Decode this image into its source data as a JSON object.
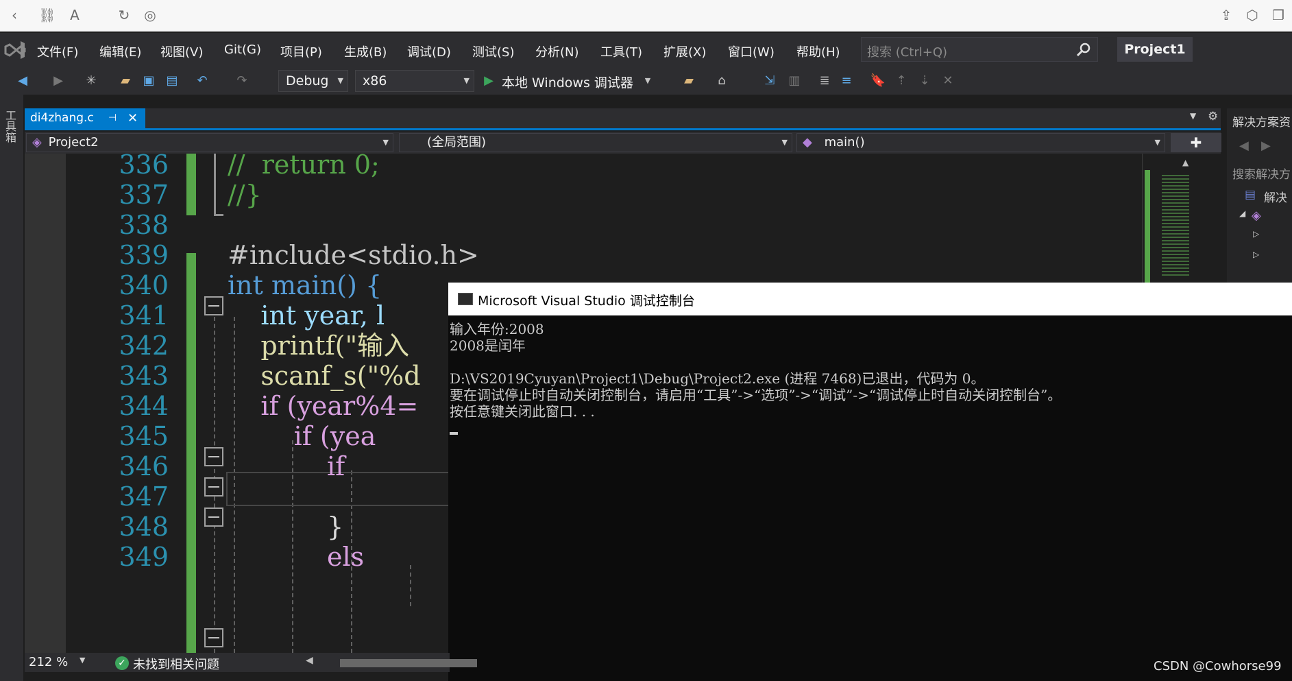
{
  "menubar": {
    "items": [
      "文件(F)",
      "编辑(E)",
      "视图(V)",
      "Git(G)",
      "项目(P)",
      "生成(B)",
      "调试(D)",
      "测试(S)",
      "分析(N)",
      "工具(T)",
      "扩展(X)",
      "窗口(W)",
      "帮助(H)"
    ],
    "search_placeholder": "搜索 (Ctrl+Q)",
    "project_title": "Project1"
  },
  "toolbar": {
    "config": "Debug",
    "platform": "x86",
    "run_label": "本地 Windows 调试器"
  },
  "left_strip": {
    "label": "工具箱"
  },
  "tabs": [
    {
      "label": "di4zhang.c",
      "active": true
    }
  ],
  "navbar": {
    "project": "Project2",
    "scope": "(全局范围)",
    "function": "main()"
  },
  "editor": {
    "lines": [
      {
        "n": "336",
        "code": "//  return 0;"
      },
      {
        "n": "337",
        "code": "//}"
      },
      {
        "n": "338",
        "code": ""
      },
      {
        "n": "339",
        "code": "#include<stdio.h>"
      },
      {
        "n": "340",
        "code": "int main() {"
      },
      {
        "n": "341",
        "code": "    int year, l"
      },
      {
        "n": "342",
        "code": "    printf(\"输入"
      },
      {
        "n": "343",
        "code": "    scanf_s(\"%d"
      },
      {
        "n": "344",
        "code": "    if (year%4="
      },
      {
        "n": "345",
        "code": "        if (yea"
      },
      {
        "n": "346",
        "code": "            if"
      },
      {
        "n": "347",
        "code": ""
      },
      {
        "n": "348",
        "code": "            }"
      },
      {
        "n": "349",
        "code": "            els"
      }
    ]
  },
  "solution_explorer": {
    "title": "解决方案资",
    "search": "搜索解决方",
    "root": "解决"
  },
  "console": {
    "title": "Microsoft Visual Studio 调试控制台",
    "lines": [
      "输入年份:2008",
      "2008是闰年",
      "",
      "D:\\VS2019Cyuyan\\Project1\\Debug\\Project2.exe (进程 7468)已退出，代码为 0。",
      "要在调试停止时自动关闭控制台，请启用“工具”->“选项”->“调试”->“调试停止时自动关闭控制台”。",
      "按任意键关闭此窗口. . ."
    ]
  },
  "statusbar": {
    "zoom": "212 %",
    "issues": "未找到相关问题"
  },
  "watermark": "CSDN @Cowhorse99",
  "colors": {
    "accent": "#007acc",
    "keyword": "#569cd6",
    "comment": "#57a64a",
    "string": "#d69d85",
    "function": "#dcdcaa",
    "line_number": "#2b91af"
  }
}
